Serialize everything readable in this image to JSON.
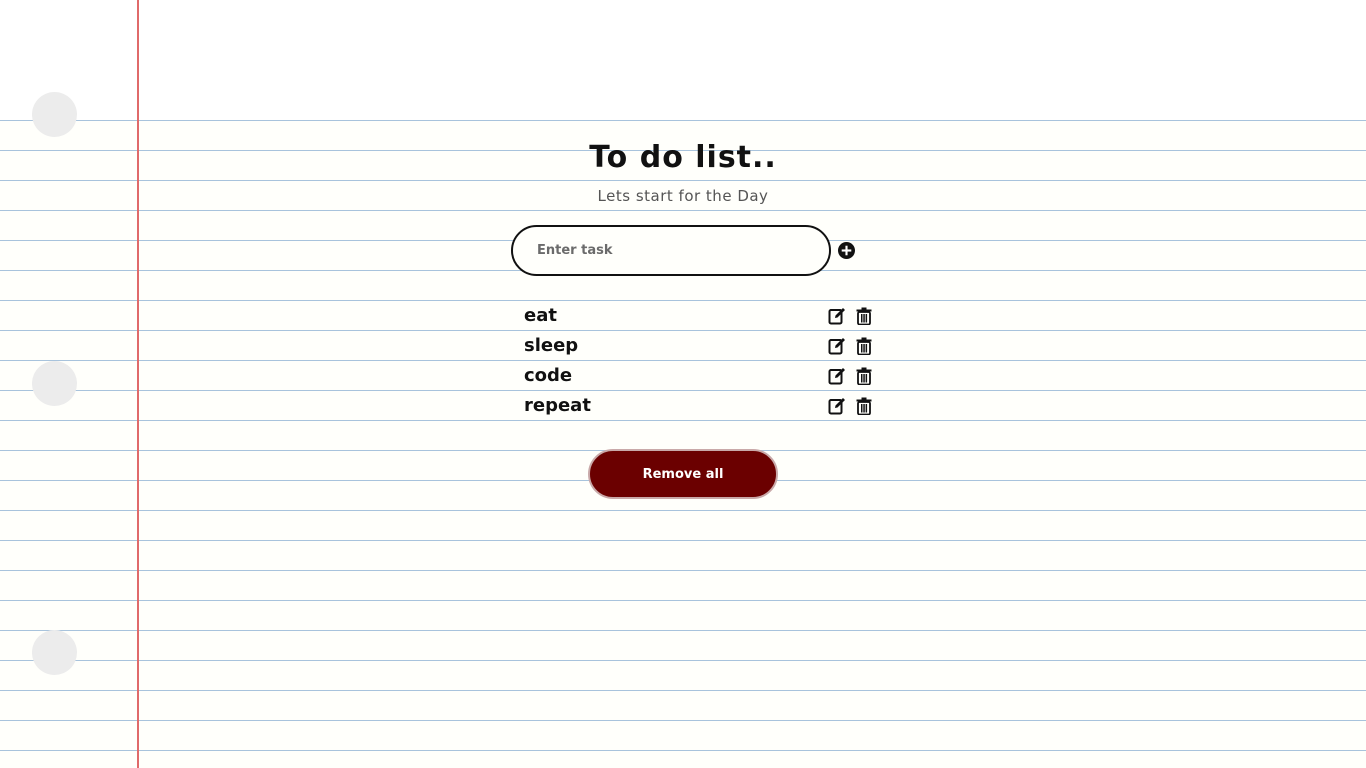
{
  "header": {
    "title": "To do list..",
    "subtitle": "Lets start for the Day"
  },
  "input": {
    "placeholder": "Enter task",
    "value": ""
  },
  "tasks": [
    {
      "text": "eat"
    },
    {
      "text": "sleep"
    },
    {
      "text": "code"
    },
    {
      "text": "repeat"
    }
  ],
  "actions": {
    "remove_all_label": "Remove all"
  },
  "icons": {
    "add": "plus-circle-icon",
    "edit": "edit-icon",
    "delete": "trash-icon"
  },
  "colors": {
    "accent": "#6b0000",
    "margin_line": "#e06a6a",
    "ruled_line": "#a8c3dc"
  }
}
